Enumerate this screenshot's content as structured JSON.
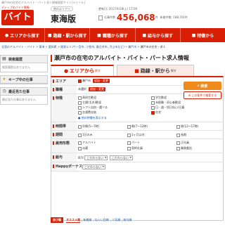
{
  "topline": "瀬戸市の在宅のアルバイト・パート求人情報検索サイト[バイトル]",
  "header": {
    "logo_tag": "ディップのバイト情報",
    "logo_text": "バイトル",
    "region_badge": "他のエリアへ",
    "region_name": "東海版",
    "update_label": "更新日: 2017/4/28(土) 17:00",
    "jobs_label": "仕事件数",
    "jobs_count": "456,068",
    "jobs_unit": "件",
    "jobs_new": "新着件数: 188,701件"
  },
  "nav": [
    {
      "label": "エリアから探す",
      "icon": "●"
    },
    {
      "label": "路線・駅から探す",
      "icon": "■"
    },
    {
      "label": "職種から探す",
      "icon": "■"
    },
    {
      "label": "給与から探す",
      "icon": "■"
    },
    {
      "label": "特徴から",
      "icon": "■"
    }
  ],
  "breadcrumb": [
    "全国のアルバイト・バイト",
    "東海",
    "愛知県",
    "尾張エリア(一宮市, 小牧市, 春日井市, 犬山市など)",
    "瀬戸市",
    "瀬戸市の在宅・求人"
  ],
  "sidebar": [
    {
      "title": "検索履歴",
      "body": "検索履歴はありません"
    },
    {
      "title": "キープ中の仕事",
      "body": ""
    },
    {
      "title": "最近見た仕事",
      "body": "最近見た仕事はありません"
    }
  ],
  "main": {
    "title": "瀬戸市の在宅のアルバイト・バイト・パート求人情報",
    "tab_area": "エリアから",
    "tab_area_small": "探す",
    "tab_route": "路線・駅から",
    "tab_route_small": "探す",
    "area_label": "エリア",
    "area_value": "瀬戸市",
    "add_change": "追加・変更",
    "job_label": "職種",
    "job_value": "未選択",
    "feature_label": "特徴",
    "features": [
      "高校生歓迎",
      "学生歓迎",
      "主婦(主夫)歓迎",
      "未経験・初心者歓迎",
      "シフト自由・選べる",
      "日・週・短日払い(日雇",
      "交通費支給",
      "在宅"
    ],
    "more_features": "● 他の特徴を表示する",
    "time_label": "時間帯",
    "times": [
      "早朝(5〜7時)",
      "朝(7〜12時)",
      "昼(12〜17時)"
    ],
    "period_label": "期間",
    "periods": [
      "1日のみ",
      "1ヶ月以内",
      "長期"
    ],
    "employ_label": "雇用形態",
    "employs": [
      "アルバイト",
      "パート",
      "正社員",
      "派遣",
      "契約社員",
      "業務委託"
    ],
    "salary_label": "給与",
    "salary_kind_label": "区分",
    "salary_kind": "こだわらない",
    "salary_amount": "こだわらない",
    "happy_label": "Happyボーナス",
    "happy_value": "こだわらない",
    "search_button": "検索",
    "keep_button": "この条件で検索する"
  },
  "footer": {
    "lead": "並び順",
    "items": [
      "オススメ順",
      "新着順",
      "ねらい目順",
      "人気順",
      "給与順"
    ]
  }
}
